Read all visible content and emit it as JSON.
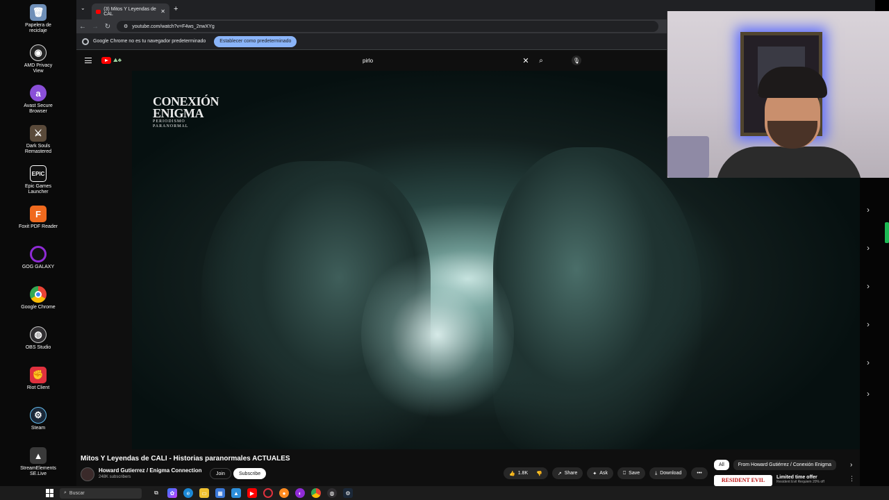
{
  "desktop": {
    "icons": [
      {
        "label": "Papelera de\nreciclaje",
        "icon": "recycle-bin-icon",
        "color": "#6f8fb8"
      },
      {
        "label": "AMD Privacy\nView",
        "icon": "amd-privacy-icon",
        "color": "#222222"
      },
      {
        "label": "Avast Secure\nBrowser",
        "icon": "avast-browser-icon",
        "color": "#8a4fd8"
      },
      {
        "label": "Dark Souls\nRemastered",
        "icon": "dark-souls-icon",
        "color": "#5a4a3a"
      },
      {
        "label": "Epic Games\nLauncher",
        "icon": "epic-games-icon",
        "color": "#111111"
      },
      {
        "label": "Foxit PDF Reader",
        "icon": "foxit-pdf-icon",
        "color": "#f06a1e"
      },
      {
        "label": "GOG GALAXY",
        "icon": "gog-galaxy-icon",
        "color": "#8f2bd6"
      },
      {
        "label": "Google Chrome",
        "icon": "chrome-icon",
        "color": "#34a853"
      },
      {
        "label": "OBS Studio",
        "icon": "obs-icon",
        "color": "#302e31"
      },
      {
        "label": "Riot Client",
        "icon": "riot-client-icon",
        "color": "#e0313e"
      },
      {
        "label": "Steam",
        "icon": "steam-icon",
        "color": "#1b2838"
      },
      {
        "label": "StreamElements\nSE.Live",
        "icon": "se-live-icon",
        "color": "#3a3a3a"
      }
    ]
  },
  "browser": {
    "tab_title": "(3) Mitos Y Leyendas de CAL",
    "url": "youtube.com/watch?v=F4ws_2nwXYg",
    "infobar_message": "Google Chrome no es tu navegador predeterminado",
    "infobar_button": "Establecer como predeterminado"
  },
  "youtube": {
    "search_query": "pirlo",
    "video_overlay": {
      "title": "CONEXIÓN",
      "title2": "ENIGMA",
      "sub": "PERIODISMO",
      "sub2": "PARANORMAL"
    },
    "video_title": "Mitos Y Leyendas de CALI - Historias paranormales ACTUALES",
    "channel_name": "Howard Gutierrez / Enigma Connection",
    "subscribers": "248K subscribers",
    "join_label": "Join",
    "subscribe_label": "Subscribe",
    "actions": {
      "likes": "1.8K",
      "share": "Share",
      "ask": "Ask",
      "save": "Save",
      "download": "Download"
    },
    "chips": {
      "all": "All",
      "from": "From Howard Gutiérrez / Conexión Enigma"
    },
    "ad": {
      "thumb": "RESIDENT EVIL",
      "title": "Limited time offer",
      "subtitle": "Resident Evil Requiem 20% off"
    }
  },
  "taskbar": {
    "search_placeholder": "Buscar"
  },
  "colors": {
    "accent": "#ff0000",
    "infobar_button": "#8ab4f8"
  }
}
